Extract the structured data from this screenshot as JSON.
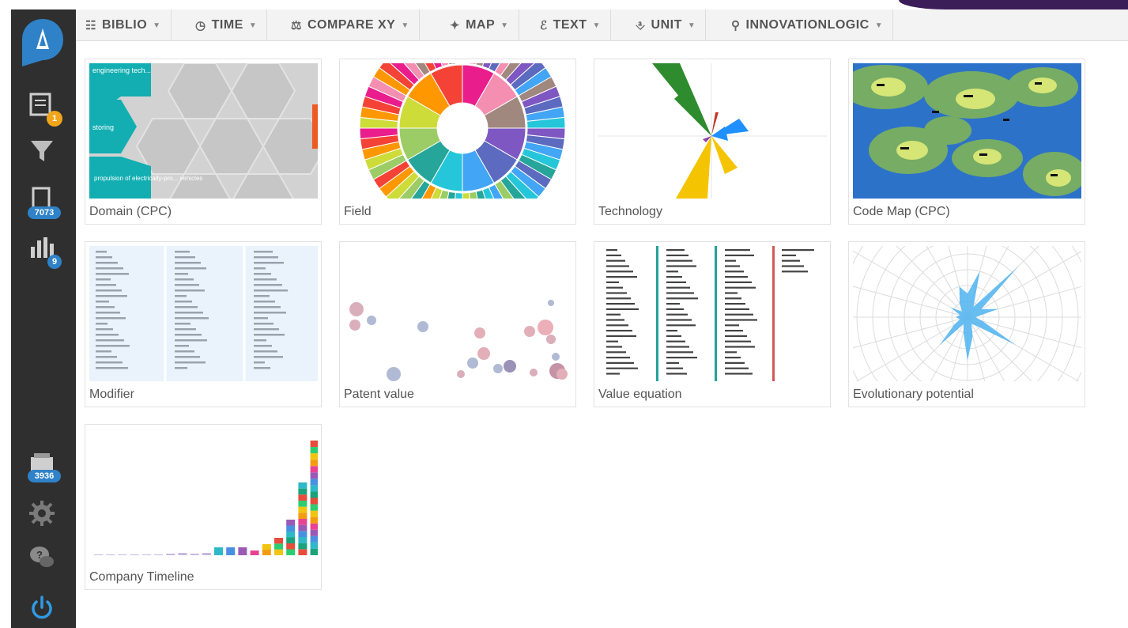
{
  "sidebar": {
    "logo_letter": "A",
    "items": [
      {
        "name": "notes",
        "badge": "1",
        "badge_color": "#f2a51a"
      },
      {
        "name": "filter"
      },
      {
        "name": "documents",
        "badge": "7073",
        "badge_color": "#2f82c8"
      },
      {
        "name": "charts",
        "badge": "9",
        "badge_color": "#2f82c8"
      },
      {
        "name": "inbox",
        "badge": "3936",
        "badge_color": "#2f82c8"
      },
      {
        "name": "settings"
      },
      {
        "name": "help"
      },
      {
        "name": "power"
      }
    ]
  },
  "toolbar": {
    "menus": [
      {
        "label": "BIBLIO",
        "icon": "book-icon"
      },
      {
        "label": "TIME",
        "icon": "clock-icon"
      },
      {
        "label": "COMPARE XY",
        "icon": "scale-icon"
      },
      {
        "label": "MAP",
        "icon": "map-icon"
      },
      {
        "label": "TEXT",
        "icon": "text-icon"
      },
      {
        "label": "UNIT",
        "icon": "link-icon"
      },
      {
        "label": "INNOVATIONLOGIC",
        "icon": "lightbulb-icon"
      }
    ]
  },
  "cards": [
    {
      "label": "Domain (CPC)",
      "thumb_text": {
        "top": "engineering tech...",
        "middle": "storing",
        "bottom": "propulsion of electrically-pro... vehicles"
      }
    },
    {
      "label": "Field"
    },
    {
      "label": "Technology"
    },
    {
      "label": "Code Map (CPC)"
    },
    {
      "label": "Modifier"
    },
    {
      "label": "Patent value"
    },
    {
      "label": "Value equation"
    },
    {
      "label": "Evolutionary potential"
    },
    {
      "label": "Company Timeline"
    }
  ],
  "colors": {
    "sidebar": "#2f2f2f",
    "accent_blue": "#2f82c8",
    "corner_purple": "#3b1d57",
    "teal": "#12aeb2",
    "badge_orange": "#f2a51a"
  }
}
